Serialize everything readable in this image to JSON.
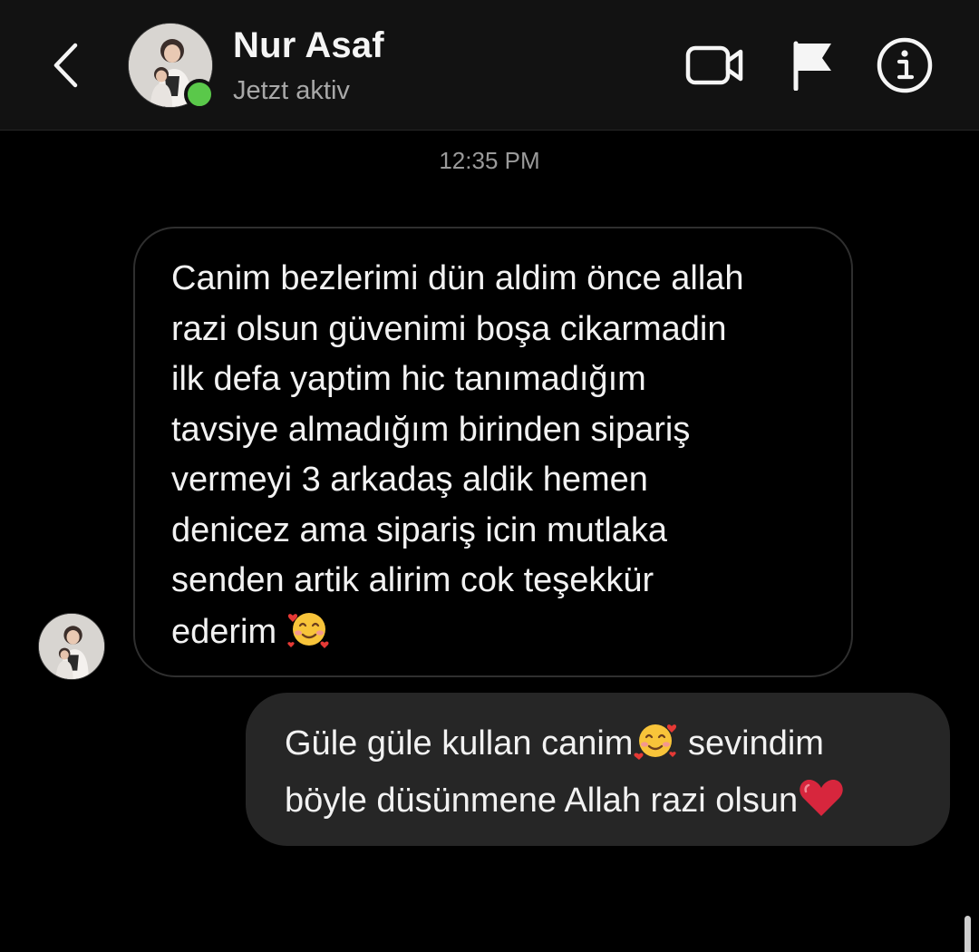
{
  "header": {
    "contact_name": "Nur Asaf",
    "contact_status": "Jetzt aktiv",
    "online_color": "#5ac84a",
    "icons": [
      "chevron-left-icon",
      "video-camera-icon",
      "flag-icon",
      "info-icon"
    ]
  },
  "conversation": {
    "timestamp": "12:35 PM",
    "messages": [
      {
        "direction": "incoming",
        "lines": [
          "Canim bezlerimi dün aldim önce allah",
          "razi olsun güvenimi boşa cikarmadin",
          "ilk defa yaptim hic tanımadığım",
          "tavsiye almadığım birinden sipariş",
          "vermeyi 3 arkadaş aldik hemen",
          "denicez ama sipariş icin mutlaka",
          "senden artik alirim cok teşekkür",
          "ederim"
        ],
        "trailing_emoji": "smiling-face-with-hearts"
      },
      {
        "direction": "outgoing",
        "line1_before_emoji": "Güle güle kullan canim",
        "line1_emoji": "smiling-face-with-hearts",
        "line1_after_emoji": " sevindim",
        "line2": "böyle düsünmene Allah razi olsun",
        "line2_emoji": "red-heart"
      }
    ]
  },
  "colors": {
    "background": "#000000",
    "header_bg": "#121212",
    "outgoing_bubble": "#262626",
    "incoming_border": "#2f2f2f",
    "secondary_text": "#a8a8a8"
  }
}
